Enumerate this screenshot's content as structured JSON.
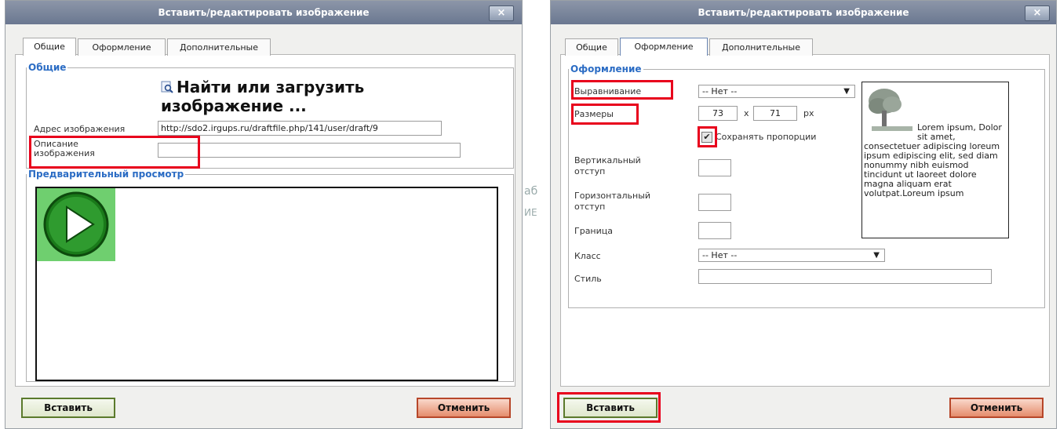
{
  "dialog_left": {
    "title": "Вставить/редактировать изображение",
    "close": "×",
    "tabs": [
      "Общие",
      "Оформление",
      "Дополнительные"
    ],
    "general_legend": "Общие",
    "find_upload_line1": "Найти или загрузить",
    "find_upload_line2": "изображение ...",
    "image_url_label": "Адрес изображения",
    "image_url_value": "http://sdo2.irgups.ru/draftfile.php/141/user/draft/9",
    "description_label_1": "Описание",
    "description_label_2": "изображения",
    "description_value": "",
    "preview_legend": "Предварительный просмотр",
    "insert": "Вставить",
    "cancel": "Отменить"
  },
  "dialog_right": {
    "title": "Вставить/редактировать изображение",
    "close": "×",
    "tabs": [
      "Общие",
      "Оформление",
      "Дополнительные"
    ],
    "appearance_legend": "Оформление",
    "align_label": "Выравнивание",
    "align_value": "-- Нет --",
    "size_label": "Размеры",
    "width": "73",
    "times": "x",
    "height": "71",
    "unit": "px",
    "keep_ratio_label": "Сохранять пропорции",
    "keep_ratio_checked": true,
    "vspace_label_1": "Вертикальный",
    "vspace_label_2": "отступ",
    "hspace_label_1": "Горизонтальный",
    "hspace_label_2": "отступ",
    "border_label": "Граница",
    "class_label": "Класс",
    "class_value": "-- Нет --",
    "style_label": "Стиль",
    "sample_text": "Lorem ipsum, Dolor sit amet, consectetuer adipiscing loreum ipsum edipiscing elit, sed diam nonummy nibh euismod tincidunt ut laoreet dolore magna aliquam erat volutpat.Loreum ipsum",
    "insert": "Вставить",
    "cancel": "Отменить"
  },
  "background_fragments": [
    "аб",
    "ИЕ"
  ]
}
